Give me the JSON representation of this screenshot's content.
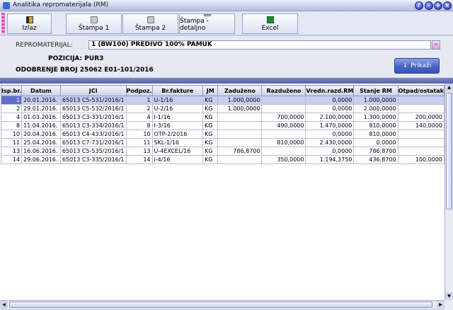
{
  "window": {
    "title": "Analitika repromaterijala (RM)"
  },
  "toolbar": {
    "izlaz": "Izlaz",
    "stampa1": "Štampa 1",
    "stampa2": "Štampa 2",
    "stampa_detaljno": "Štampa - detaljno",
    "excel": "Excel"
  },
  "header": {
    "repromaterijal_label": "REPROMATERIJAL:",
    "repromaterijal_value": "1 (BW100) PREDIVO 100% PAMUK",
    "pozicija": "POZICIJA: PUR3",
    "odobrenje": "ODOBRENJE BROJ 25062 E01-101/2016",
    "prikazi": "Prikaži"
  },
  "grid": {
    "columns": [
      "Isp.br.",
      "Datum",
      "JCI",
      "Podpoz.",
      "Br.fakture",
      "JM",
      "Zaduženo",
      "Razduženo",
      "Vredn.razd.RM",
      "Stanje RM",
      "Otpad/ostatak"
    ],
    "rows": [
      [
        "1",
        "20.01.2016.",
        "65013 C5-531/2016/1",
        "1",
        "U-1/16",
        "KG",
        "1.000,0000",
        "",
        "0,0000",
        "1.000,0000",
        ""
      ],
      [
        "2",
        "29.01.2016.",
        "65013 C5-532/2016/1",
        "2",
        "U-2/16",
        "KG",
        "1.000,0000",
        "",
        "0,0000",
        "2.000,0000",
        ""
      ],
      [
        "4",
        "01.03.2016.",
        "65013 C3-331/2016/1",
        "4",
        "I-1/16",
        "KG",
        "",
        "700,0000",
        "2.100,0000",
        "1.300,0000",
        "200,0000"
      ],
      [
        "8",
        "11.04.2016.",
        "65013 C3-334/2016/1",
        "8",
        "I-3/16",
        "KG",
        "",
        "490,0000",
        "1.470,0000",
        "810,0000",
        "140,0000"
      ],
      [
        "10",
        "20.04.2016.",
        "65013 C4-433/2016/1",
        "10",
        "OTP-2/2016",
        "KG",
        "",
        "",
        "0,0000",
        "810,0000",
        ""
      ],
      [
        "11",
        "25.04.2016.",
        "65013 C7-731/2016/1",
        "11",
        "SKL-1/16",
        "KG",
        "",
        "810,0000",
        "2.430,0000",
        "0,0000",
        ""
      ],
      [
        "13",
        "16.06.2016.",
        "65013 C5-535/2016/1",
        "13",
        "U-4EXCEL/16",
        "KG",
        "786,8700",
        "",
        "0,0000",
        "786,8700",
        ""
      ],
      [
        "14",
        "29.06.2016.",
        "65013 C3-335/2016/1",
        "14",
        "i-4/16",
        "KG",
        "",
        "350,0000",
        "1.194,3750",
        "436,8700",
        "100,0000"
      ]
    ]
  }
}
